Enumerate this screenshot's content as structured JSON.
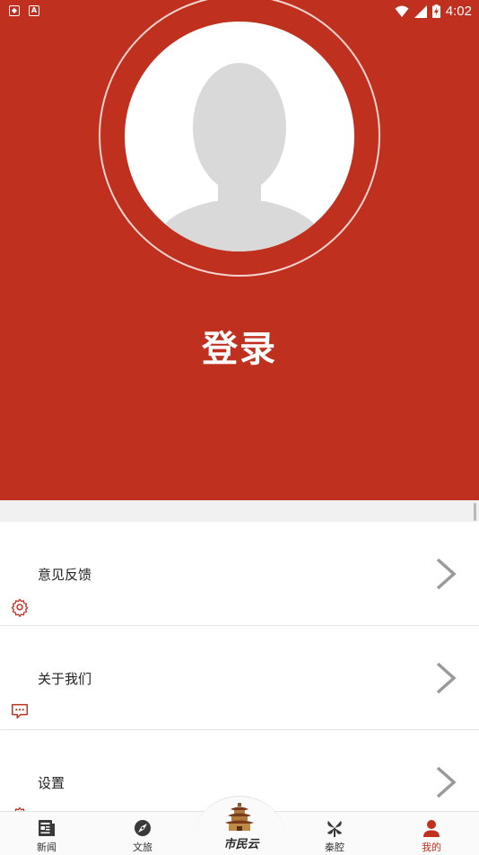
{
  "status_bar": {
    "time": "4:02",
    "icons": [
      "shield-notification-icon",
      "a-notification-icon",
      "wifi-icon",
      "signal-icon",
      "battery-charging-icon"
    ]
  },
  "profile": {
    "login_label": "登录",
    "avatar": "default-user-avatar"
  },
  "menu": {
    "items": [
      {
        "label": "意见反馈",
        "icon": "gear-icon"
      },
      {
        "label": "关于我们",
        "icon": "chat-bubble-icon"
      },
      {
        "label": "设置",
        "icon": "gear-icon"
      }
    ]
  },
  "bottom_nav": {
    "items": [
      {
        "label": "新闻",
        "icon": "newspaper-icon"
      },
      {
        "label": "文旅",
        "icon": "compass-icon"
      },
      {
        "label": "秦腔",
        "icon": "fan-icon"
      },
      {
        "label": "我的",
        "icon": "person-icon",
        "active": true
      }
    ],
    "center_label": "市民云"
  },
  "colors": {
    "brand_red": "#c0301f",
    "active_nav": "#c0301f"
  }
}
